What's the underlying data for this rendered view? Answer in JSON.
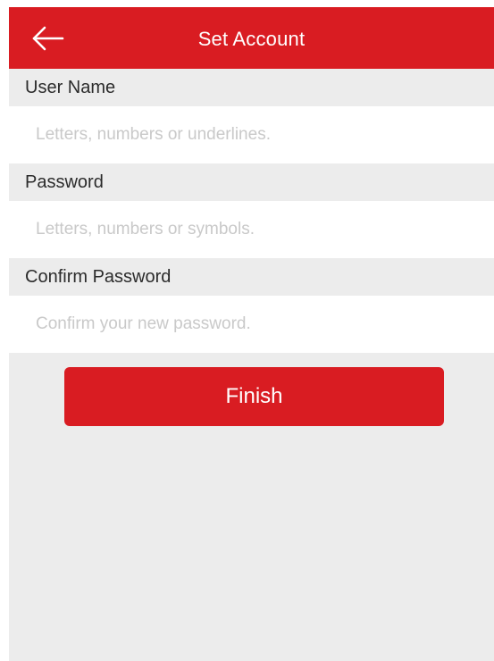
{
  "header": {
    "title": "Set Account",
    "back_icon": "arrow-left-icon"
  },
  "form": {
    "username": {
      "label": "User Name",
      "placeholder": "Letters, numbers or underlines.",
      "value": ""
    },
    "password": {
      "label": "Password",
      "placeholder": "Letters, numbers or symbols.",
      "value": ""
    },
    "confirm_password": {
      "label": "Confirm Password",
      "placeholder": "Confirm your new password.",
      "value": ""
    }
  },
  "actions": {
    "finish_label": "Finish"
  },
  "colors": {
    "accent": "#d91c22",
    "background": "#ececec",
    "field_background": "#ffffff",
    "placeholder": "#c9c9c9"
  }
}
